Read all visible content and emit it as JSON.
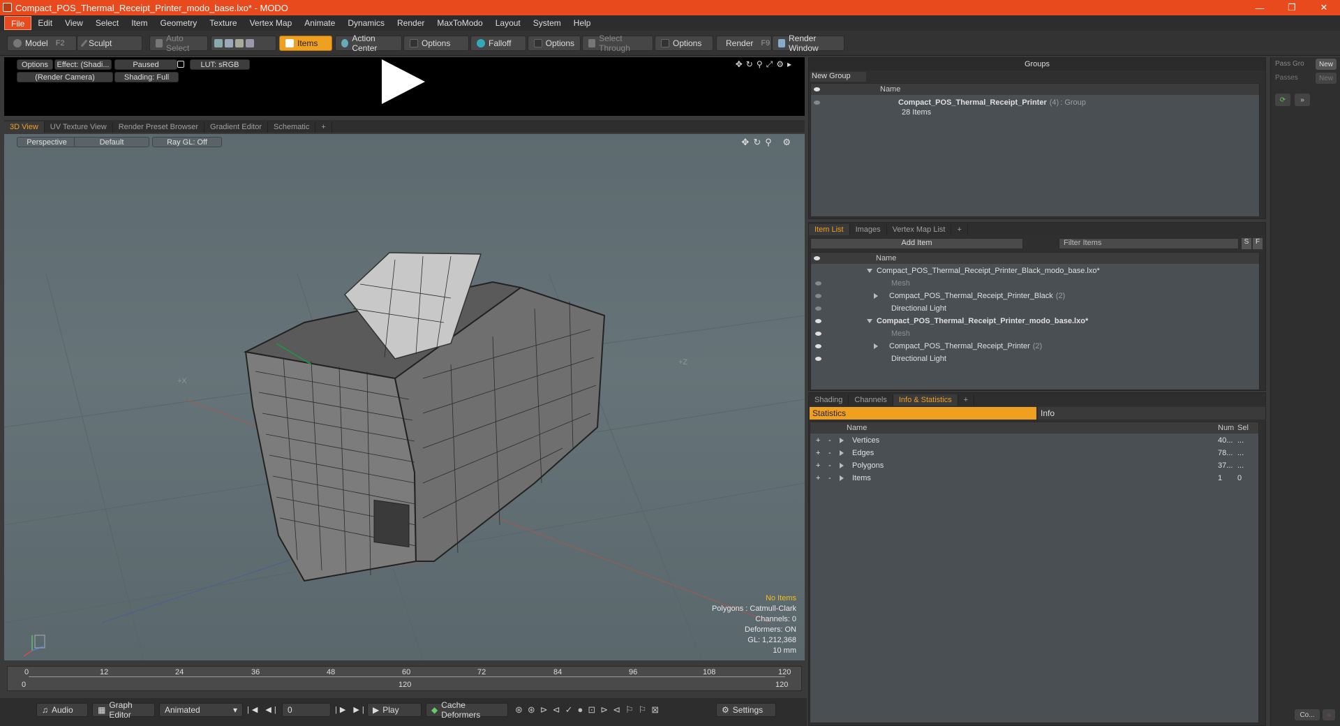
{
  "window": {
    "title": "Compact_POS_Thermal_Receipt_Printer_modo_base.lxo* - MODO"
  },
  "menu": [
    "File",
    "Edit",
    "View",
    "Select",
    "Item",
    "Geometry",
    "Texture",
    "Vertex Map",
    "Animate",
    "Dynamics",
    "Render",
    "MaxToModo",
    "Layout",
    "System",
    "Help"
  ],
  "toolbar": {
    "model": "Model",
    "model_key": "F2",
    "sculpt": "Sculpt",
    "auto_select": "Auto Select",
    "items": "Items",
    "action_center": "Action Center",
    "options": "Options",
    "falloff": "Falloff",
    "select_through": "Select Through",
    "render": "Render",
    "render_key": "F9",
    "render_window": "Render Window"
  },
  "preview": {
    "options": "Options",
    "effect": "Effect: (Shadi...",
    "paused": "Paused",
    "lut": "LUT: sRGB",
    "camera": "(Render Camera)",
    "shading": "Shading: Full"
  },
  "view_tabs": [
    "3D View",
    "UV Texture View",
    "Render Preset Browser",
    "Gradient Editor",
    "Schematic",
    "+"
  ],
  "viewport": {
    "perspective": "Perspective",
    "default": "Default",
    "raygl": "Ray GL: Off",
    "stats": {
      "items": "No Items",
      "polygons": "Polygons : Catmull-Clark",
      "channels": "Channels: 0",
      "deformers": "Deformers: ON",
      "gl": "GL: 1,212,368",
      "unit": "10 mm"
    }
  },
  "timeline": {
    "ticks": [
      "0",
      "12",
      "24",
      "36",
      "48",
      "60",
      "72",
      "84",
      "96",
      "108",
      "120"
    ],
    "sub_ticks": [
      "0",
      "120",
      "120"
    ]
  },
  "bottom": {
    "audio": "Audio",
    "graph_editor": "Graph Editor",
    "animated": "Animated",
    "frame": "0",
    "play": "Play",
    "cache": "Cache Deformers",
    "settings": "Settings"
  },
  "groups": {
    "title": "Groups",
    "new_group": "New Group",
    "col_name": "Name",
    "item_name": "Compact_POS_Thermal_Receipt_Printer",
    "item_count": "(4)",
    "item_type": ": Group",
    "item_sub": "28 Items"
  },
  "item_list": {
    "tabs": [
      "Item List",
      "Images",
      "Vertex Map List",
      "+"
    ],
    "add_item": "Add Item",
    "filter": "Filter Items",
    "s": "S",
    "f": "F",
    "col_name": "Name",
    "rows": [
      {
        "label": "Compact_POS_Thermal_Receipt_Printer_Black_modo_base.lxo*",
        "extra": ""
      },
      {
        "label": "Mesh",
        "extra": ""
      },
      {
        "label": "Compact_POS_Thermal_Receipt_Printer_Black",
        "extra": "(2)"
      },
      {
        "label": "Directional Light",
        "extra": ""
      },
      {
        "label": "Compact_POS_Thermal_Receipt_Printer_modo_base.lxo*",
        "extra": ""
      },
      {
        "label": "Mesh",
        "extra": ""
      },
      {
        "label": "Compact_POS_Thermal_Receipt_Printer",
        "extra": "(2)"
      },
      {
        "label": "Directional Light",
        "extra": ""
      }
    ]
  },
  "stats_panel": {
    "tabs": [
      "Shading",
      "Channels",
      "Info & Statistics",
      "+"
    ],
    "statistics": "Statistics",
    "info": "Info",
    "cols": {
      "name": "Name",
      "num": "Num",
      "sel": "Sel"
    },
    "rows": [
      {
        "name": "Vertices",
        "num": "40...",
        "sel": "..."
      },
      {
        "name": "Edges",
        "num": "78...",
        "sel": "..."
      },
      {
        "name": "Polygons",
        "num": "37...",
        "sel": "..."
      },
      {
        "name": "Items",
        "num": "1",
        "sel": "0"
      }
    ]
  },
  "right_strip": {
    "pass_groups": "Pass Gro",
    "new1": "New",
    "passes": "Passes",
    "new2": "New",
    "co": "Co..."
  }
}
